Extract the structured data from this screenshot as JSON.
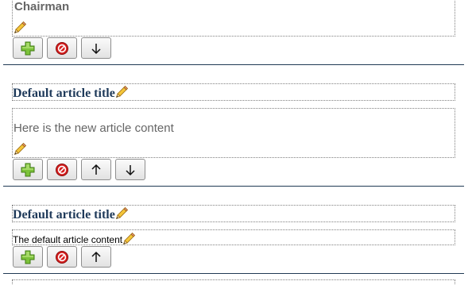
{
  "sections": [
    {
      "body_text": "Chairman",
      "buttons": [
        "add",
        "remove",
        "move-down"
      ]
    },
    {
      "title": "Default article title",
      "body_text": "Here is the new article content",
      "buttons": [
        "add",
        "remove",
        "move-up",
        "move-down"
      ]
    },
    {
      "title": "Default article title",
      "body_text": "The default article content",
      "buttons": [
        "add",
        "remove",
        "move-up"
      ]
    }
  ],
  "colors": {
    "title": "#1f3a5a",
    "separator": "#203a54",
    "muted_text": "#666666"
  },
  "icons": {
    "add": "green-plus-icon",
    "remove": "red-no-entry-icon",
    "move_up": "arrow-up-icon",
    "move_down": "arrow-down-icon",
    "edit": "pencil-icon"
  }
}
